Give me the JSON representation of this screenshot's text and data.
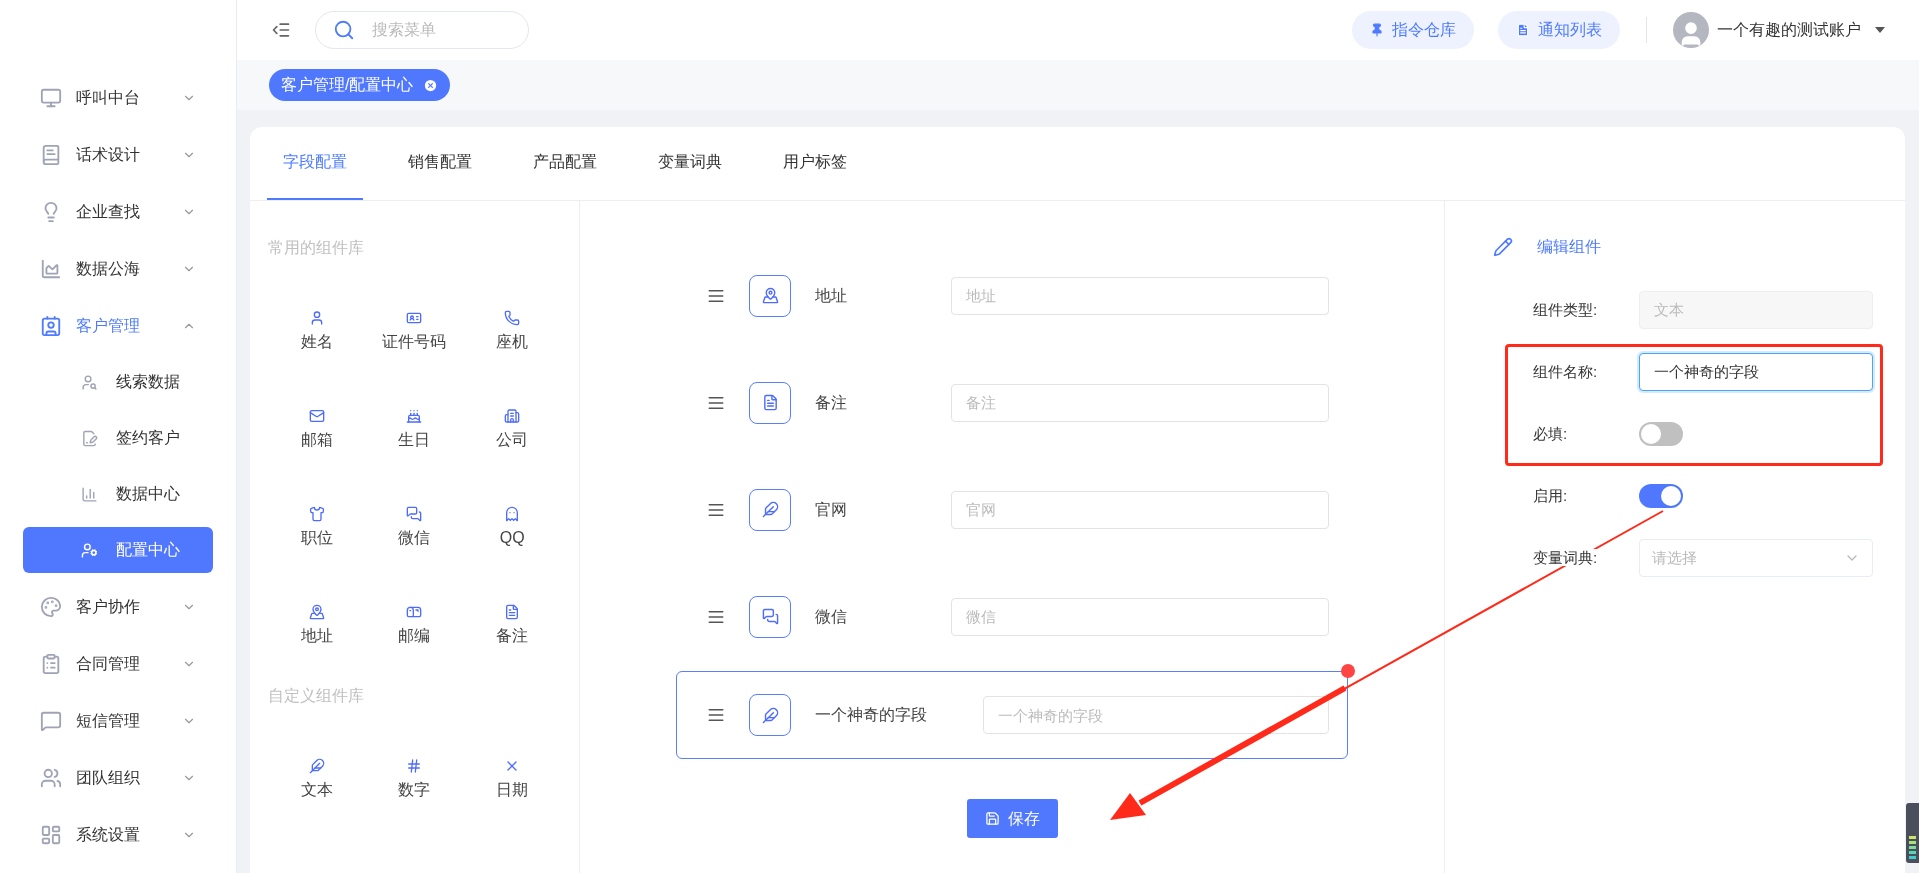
{
  "sidebar": {
    "items": [
      {
        "label": "呼叫中台",
        "expanded": false
      },
      {
        "label": "话术设计",
        "expanded": false
      },
      {
        "label": "企业查找",
        "expanded": false
      },
      {
        "label": "数据公海",
        "expanded": false
      },
      {
        "label": "客户管理",
        "expanded": true,
        "children": [
          {
            "label": "线索数据",
            "selected": false
          },
          {
            "label": "签约客户",
            "selected": false
          },
          {
            "label": "数据中心",
            "selected": false
          },
          {
            "label": "配置中心",
            "selected": true
          }
        ]
      },
      {
        "label": "客户协作",
        "expanded": false
      },
      {
        "label": "合同管理",
        "expanded": false
      },
      {
        "label": "短信管理",
        "expanded": false
      },
      {
        "label": "团队组织",
        "expanded": false
      },
      {
        "label": "系统设置",
        "expanded": false
      }
    ]
  },
  "header": {
    "search": {
      "placeholder": "搜索菜单"
    },
    "buttons": [
      {
        "label": "指令仓库"
      },
      {
        "label": "通知列表"
      }
    ],
    "user": "一个有趣的测试账户"
  },
  "tags": [
    {
      "label": "客户管理/配置中心",
      "selected": true
    }
  ],
  "tabs": [
    {
      "label": "字段配置",
      "selected": true
    },
    {
      "label": "销售配置",
      "selected": false
    },
    {
      "label": "产品配置",
      "selected": false
    },
    {
      "label": "变量词典",
      "selected": false
    },
    {
      "label": "用户标签",
      "selected": false
    }
  ],
  "library": [
    {
      "title": "常用的组件库",
      "items": [
        {
          "label": "姓名",
          "kind": "person"
        },
        {
          "label": "证件号码",
          "kind": "idcard"
        },
        {
          "label": "座机",
          "kind": "phone"
        },
        {
          "label": "邮箱",
          "kind": "mail"
        },
        {
          "label": "生日",
          "kind": "cake"
        },
        {
          "label": "公司",
          "kind": "building"
        },
        {
          "label": "职位",
          "kind": "tie"
        },
        {
          "label": "微信",
          "kind": "chat"
        },
        {
          "label": "QQ",
          "kind": "qq"
        },
        {
          "label": "地址",
          "kind": "map"
        },
        {
          "label": "邮编",
          "kind": "mailbox"
        },
        {
          "label": "备注",
          "kind": "doc"
        }
      ]
    },
    {
      "title": "自定义组件库",
      "items": [
        {
          "label": "文本",
          "kind": "feather"
        },
        {
          "label": "数字",
          "kind": "number"
        },
        {
          "label": "日期",
          "kind": "cross"
        }
      ]
    }
  ],
  "form": {
    "rows": [
      {
        "label": "地址",
        "placeholder": "地址",
        "kind": "map",
        "selected": false
      },
      {
        "label": "备注",
        "placeholder": "备注",
        "kind": "doc",
        "selected": false
      },
      {
        "label": "官网",
        "placeholder": "官网",
        "kind": "feather",
        "selected": false
      },
      {
        "label": "微信",
        "placeholder": "微信",
        "kind": "chat",
        "selected": false
      },
      {
        "label": "一个神奇的字段",
        "placeholder": "一个神奇的字段",
        "kind": "feather",
        "selected": true
      }
    ],
    "save": "保存"
  },
  "editor": {
    "title": "编辑组件",
    "fields": [
      {
        "label": "组件类型:",
        "kind": "input",
        "value": "文本",
        "disabled": true
      },
      {
        "label": "组件名称:",
        "kind": "input",
        "value": "一个神奇的字段",
        "disabled": false
      },
      {
        "label": "必填:",
        "kind": "switch",
        "on": false
      },
      {
        "label": "启用:",
        "kind": "switch",
        "on": true
      },
      {
        "label": "变量词典:",
        "kind": "select",
        "placeholder": "请选择"
      }
    ]
  }
}
